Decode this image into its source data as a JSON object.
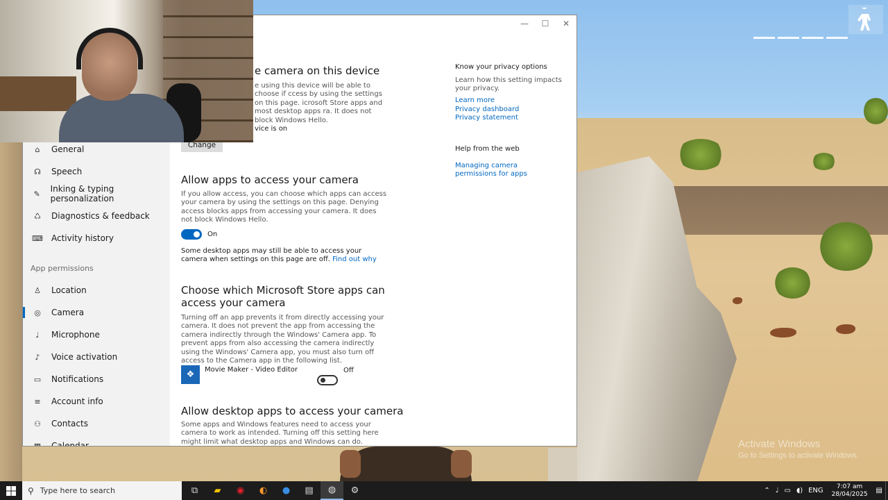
{
  "window": {
    "controls": {
      "minimize": "—",
      "maximize": "☐",
      "close": "✕"
    }
  },
  "sidebar": {
    "items_top": [
      {
        "label": "General",
        "icon": "lock-icon",
        "glyph": "⌂"
      },
      {
        "label": "Speech",
        "icon": "speech-icon",
        "glyph": "☊"
      },
      {
        "label": "Inking & typing personalization",
        "icon": "pen-icon",
        "glyph": "✎"
      },
      {
        "label": "Diagnostics & feedback",
        "icon": "feedback-icon",
        "glyph": "♺"
      },
      {
        "label": "Activity history",
        "icon": "history-icon",
        "glyph": "⌨"
      }
    ],
    "section_label": "App permissions",
    "items_perm": [
      {
        "label": "Location",
        "icon": "location-icon",
        "glyph": "♙"
      },
      {
        "label": "Camera",
        "icon": "camera-icon",
        "glyph": "◎"
      },
      {
        "label": "Microphone",
        "icon": "microphone-icon",
        "glyph": "♩"
      },
      {
        "label": "Voice activation",
        "icon": "voice-icon",
        "glyph": "♪"
      },
      {
        "label": "Notifications",
        "icon": "notifications-icon",
        "glyph": "▭"
      },
      {
        "label": "Account info",
        "icon": "account-icon",
        "glyph": "≡"
      },
      {
        "label": "Contacts",
        "icon": "contacts-icon",
        "glyph": "⚇"
      },
      {
        "label": "Calendar",
        "icon": "calendar-icon",
        "glyph": "▦"
      }
    ]
  },
  "main": {
    "device_heading": "e camera on this device",
    "device_desc": "e using this device will be able to choose if ccess by using the settings on this page. icrosoft Store apps and most desktop apps ra. It does not block Windows Hello.",
    "device_status": "vice is on",
    "change_button": "Change",
    "allow_heading": "Allow apps to access your camera",
    "allow_desc": "If you allow access, you can choose which apps can access your camera by using the settings on this page. Denying access blocks apps from accessing your camera. It does not block Windows Hello.",
    "allow_toggle_label": "On",
    "desktop_note": "Some desktop apps may still be able to access your camera when settings on this page are off.",
    "find_out_why": "Find out why",
    "store_heading": "Choose which Microsoft Store apps can access your camera",
    "store_desc": "Turning off an app prevents it from directly accessing your camera. It does not prevent the app from accessing the camera indirectly through the Windows' Camera app. To prevent apps from also accessing the camera indirectly using the Windows' Camera app, you must also turn off access to the Camera app in the following list.",
    "app_name": "Movie Maker - Video Editor",
    "app_toggle_label": "Off",
    "desktop_heading": "Allow desktop apps to access your camera",
    "desktop_desc": "Some apps and Windows features need to access your camera to work as intended. Turning off this setting here might limit what desktop apps and Windows can do."
  },
  "side_panel": {
    "privacy_heading": "Know your privacy options",
    "privacy_desc": "Learn how this setting impacts your privacy.",
    "links": [
      "Learn more",
      "Privacy dashboard",
      "Privacy statement"
    ],
    "help_heading": "Help from the web",
    "help_link": "Managing camera permissions for apps"
  },
  "taskbar": {
    "search_placeholder": "Type here to search",
    "apps": [
      {
        "name": "task-view-icon",
        "glyph": "⧉"
      },
      {
        "name": "file-explorer-icon",
        "glyph": "▰"
      },
      {
        "name": "opera-icon",
        "glyph": "◉"
      },
      {
        "name": "browser-icon",
        "glyph": "◐"
      },
      {
        "name": "blue-app-icon",
        "glyph": "●"
      },
      {
        "name": "media-app-icon",
        "glyph": "▤"
      },
      {
        "name": "game-app-icon",
        "glyph": "◍"
      },
      {
        "name": "settings-icon",
        "glyph": "⚙"
      }
    ],
    "language": "ENG",
    "time": "7:07 am",
    "date": "28/04/2025"
  },
  "watermark": {
    "line1": "Activate Windows",
    "line2": "Go to Settings to activate Windows."
  }
}
